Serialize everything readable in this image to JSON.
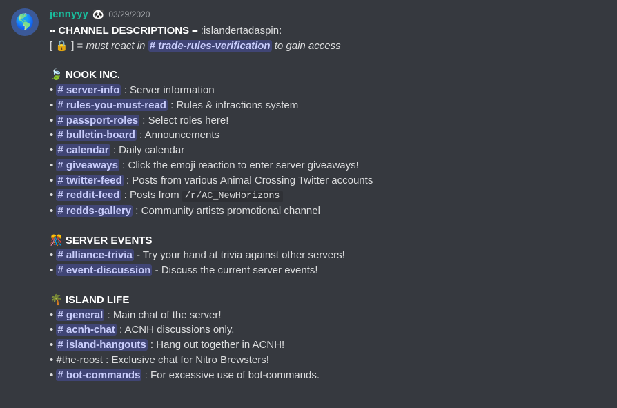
{
  "author": {
    "name": "jennyyy",
    "badge": "🐼"
  },
  "timestamp": "03/29/2020",
  "header": {
    "prefix": "⬝⬝ ",
    "title": "CHANNEL DESCRIPTIONS",
    "suffix": " ⬝⬝",
    "spin": " :islandertadaspin:"
  },
  "legend": {
    "open": "[ ",
    "lock": "🔒",
    "mid": " ] = ",
    "must": "must react in",
    "trade": "# trade-rules-verification",
    "end": "to gain access"
  },
  "sections": [
    {
      "emoji": "🍃",
      "title": " NOOK INC.",
      "items": [
        {
          "ch": "# server-info",
          "sep": " : ",
          "desc": "Server information"
        },
        {
          "ch": "# rules-you-must-read",
          "sep": " : ",
          "desc": "Rules & infractions system"
        },
        {
          "ch": "# passport-roles",
          "sep": " : ",
          "desc": "Select roles here!"
        },
        {
          "ch": "# bulletin-board",
          "sep": " : ",
          "desc": "Announcements"
        },
        {
          "ch": "# calendar",
          "sep": " : ",
          "desc": "Daily calendar"
        },
        {
          "ch": "# giveaways",
          "sep": " : ",
          "desc": "Click the emoji reaction to enter server giveaways!"
        },
        {
          "ch": "# twitter-feed",
          "sep": " : ",
          "desc": "Posts from various Animal Crossing Twitter accounts"
        },
        {
          "ch": "# reddit-feed",
          "sep": " : ",
          "desc": "Posts from ",
          "code": "/r/AC_NewHorizons"
        },
        {
          "ch": "# redds-gallery",
          "sep": " : ",
          "desc": "Community artists promotional channel"
        }
      ]
    },
    {
      "emoji": "🎊",
      "title": " SERVER EVENTS",
      "items": [
        {
          "ch": "# alliance-trivia",
          "sep": " - ",
          "desc": "Try your hand at trivia against other servers!"
        },
        {
          "ch": "# event-discussion",
          "sep": " - ",
          "desc": "Discuss the current server events!"
        }
      ]
    },
    {
      "emoji": "🌴",
      "title": " ISLAND LIFE",
      "items": [
        {
          "ch": "# general",
          "sep": " : ",
          "desc": "Main chat of the server!"
        },
        {
          "ch": "# acnh-chat",
          "sep": " : ",
          "desc": "ACNH discussions only."
        },
        {
          "ch": "# island-hangouts",
          "sep": " : ",
          "desc": "Hang out together in ACNH!"
        },
        {
          "plain": "#the-roost",
          "sep": " : ",
          "desc": "Exclusive chat for Nitro Brewsters!"
        },
        {
          "ch": "# bot-commands",
          "sep": " : ",
          "desc": "For excessive use of bot-commands."
        }
      ]
    }
  ]
}
